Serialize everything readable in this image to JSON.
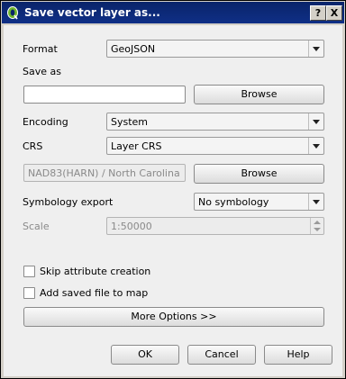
{
  "window": {
    "title": "Save vector layer as...",
    "help_glyph": "?",
    "close_glyph": "X",
    "icon": "qgis-logo-icon"
  },
  "form": {
    "format": {
      "label": "Format",
      "value": "GeoJSON"
    },
    "save_as": {
      "label": "Save as",
      "value": "",
      "browse_label": "Browse"
    },
    "encoding": {
      "label": "Encoding",
      "value": "System"
    },
    "crs": {
      "label": "CRS",
      "value": "Layer CRS",
      "selected_crs": "NAD83(HARN) / North Carolina",
      "browse_label": "Browse"
    },
    "symbology": {
      "label": "Symbology export",
      "value": "No symbology"
    },
    "scale": {
      "label": "Scale",
      "value": "1:50000"
    }
  },
  "options": {
    "skip_attr": {
      "label": "Skip attribute creation",
      "checked": false
    },
    "add_to_map": {
      "label": "Add saved file to map",
      "checked": false
    },
    "more_options_label": "More Options >>"
  },
  "buttons": {
    "ok": "OK",
    "cancel": "Cancel",
    "help": "Help"
  },
  "colors": {
    "titlebar": "#0a246a",
    "dialog_bg": "#efefef",
    "frame": "#d4d0c8"
  }
}
